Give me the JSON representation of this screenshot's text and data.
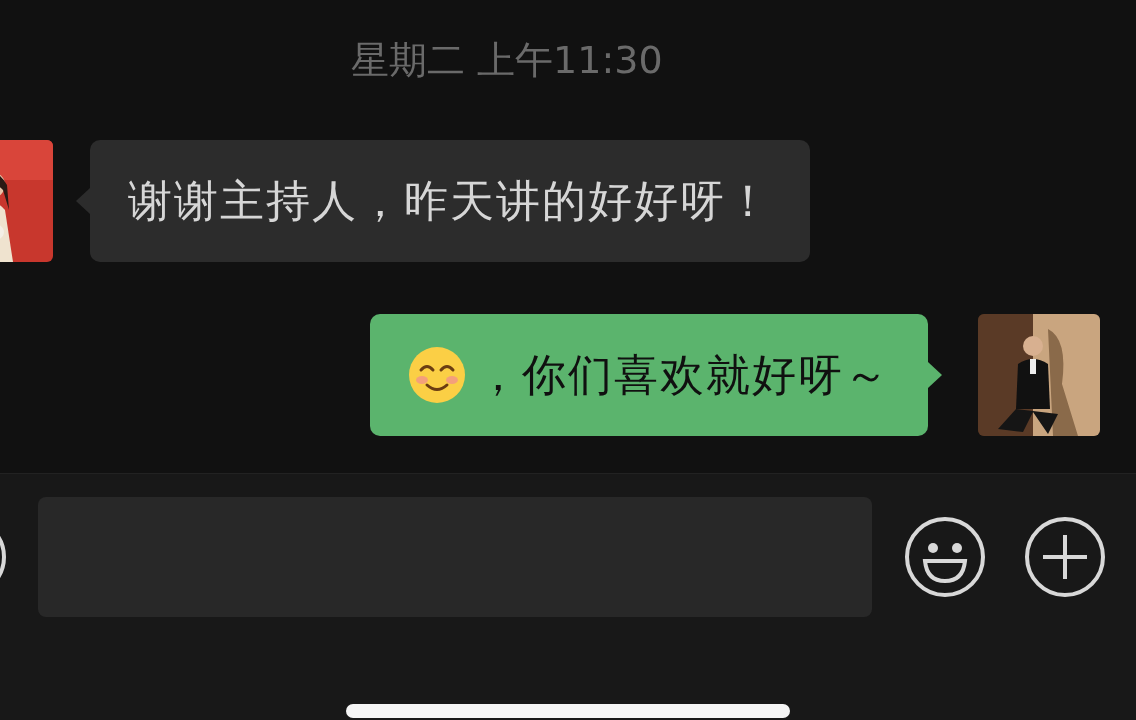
{
  "timestamp": "星期二 上午11:30",
  "messages": [
    {
      "kind": "received",
      "text": "谢谢主持人，昨天讲的好好呀！",
      "emoji": false
    },
    {
      "kind": "sent",
      "text": "，你们喜欢就好呀～",
      "emoji": true
    }
  ]
}
